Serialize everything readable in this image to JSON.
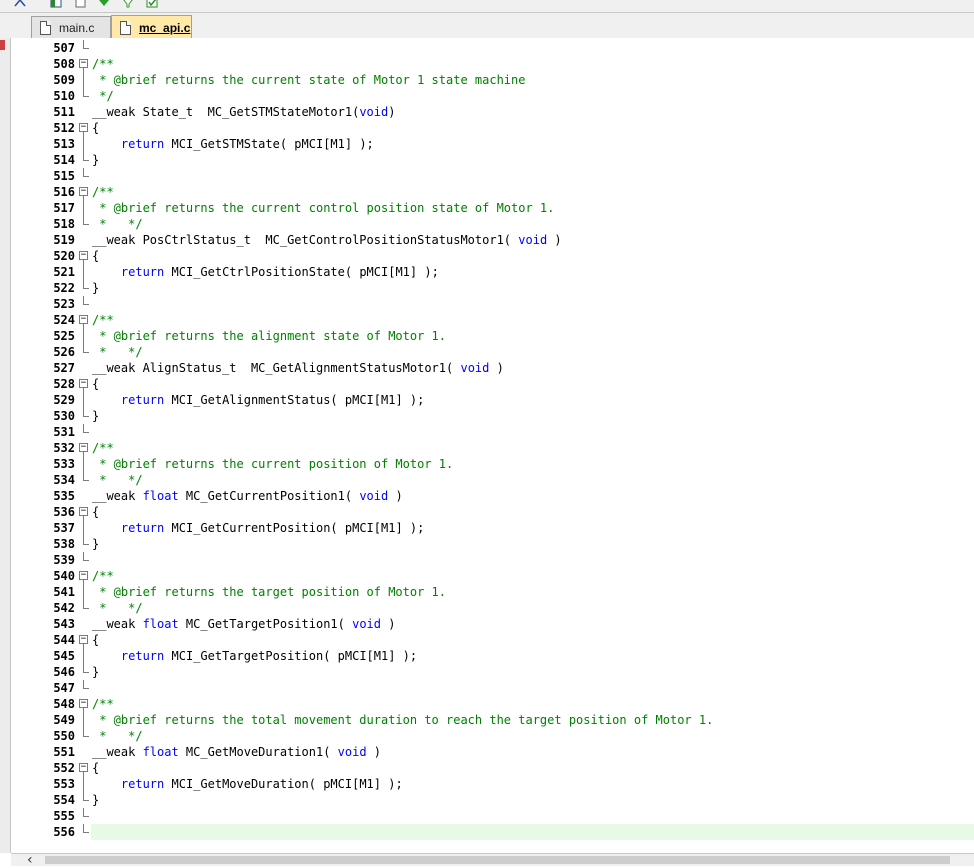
{
  "tabs": [
    {
      "label": "main.c",
      "active": false
    },
    {
      "label": "mc_api.c",
      "active": true
    }
  ],
  "toolbar_icons": [
    "debug-icon",
    "window-icon",
    "window-restore-icon",
    "arrow-down-icon",
    "filter-icon",
    "checkbox-icon"
  ],
  "editor": {
    "current_line": "556",
    "lines": [
      {
        "num": "507",
        "fold": "end",
        "segments": []
      },
      {
        "num": "508",
        "fold": "open",
        "segments": [
          {
            "t": "/**",
            "c": "cm"
          }
        ]
      },
      {
        "num": "509",
        "fold": "bar",
        "segments": [
          {
            "t": " * @brief returns the current state of Motor 1 state machine",
            "c": "cm"
          }
        ]
      },
      {
        "num": "510",
        "fold": "end",
        "segments": [
          {
            "t": " */",
            "c": "cm"
          }
        ]
      },
      {
        "num": "511",
        "fold": "",
        "segments": [
          {
            "t": "__weak State_t  MC_GetSTMStateMotor1(",
            "c": ""
          },
          {
            "t": "void",
            "c": "kw"
          },
          {
            "t": ")",
            "c": ""
          }
        ]
      },
      {
        "num": "512",
        "fold": "open",
        "segments": [
          {
            "t": "{",
            "c": ""
          }
        ]
      },
      {
        "num": "513",
        "fold": "bar",
        "segments": [
          {
            "t": "    ",
            "c": ""
          },
          {
            "t": "return",
            "c": "kw"
          },
          {
            "t": " MCI_GetSTMState( pMCI[M1] );",
            "c": ""
          }
        ]
      },
      {
        "num": "514",
        "fold": "end",
        "segments": [
          {
            "t": "}",
            "c": ""
          }
        ]
      },
      {
        "num": "515",
        "fold": "end",
        "segments": []
      },
      {
        "num": "516",
        "fold": "open",
        "segments": [
          {
            "t": "/**",
            "c": "cm"
          }
        ]
      },
      {
        "num": "517",
        "fold": "bar",
        "segments": [
          {
            "t": " * @brief returns the current control position state of Motor 1.",
            "c": "cm"
          }
        ]
      },
      {
        "num": "518",
        "fold": "end",
        "segments": [
          {
            "t": " *   */",
            "c": "cm"
          }
        ]
      },
      {
        "num": "519",
        "fold": "",
        "segments": [
          {
            "t": "__weak PosCtrlStatus_t  MC_GetControlPositionStatusMotor1( ",
            "c": ""
          },
          {
            "t": "void",
            "c": "kw"
          },
          {
            "t": " )",
            "c": ""
          }
        ]
      },
      {
        "num": "520",
        "fold": "open",
        "segments": [
          {
            "t": "{",
            "c": ""
          }
        ]
      },
      {
        "num": "521",
        "fold": "bar",
        "segments": [
          {
            "t": "    ",
            "c": ""
          },
          {
            "t": "return",
            "c": "kw"
          },
          {
            "t": " MCI_GetCtrlPositionState( pMCI[M1] );",
            "c": ""
          }
        ]
      },
      {
        "num": "522",
        "fold": "end",
        "segments": [
          {
            "t": "}",
            "c": ""
          }
        ]
      },
      {
        "num": "523",
        "fold": "end",
        "segments": []
      },
      {
        "num": "524",
        "fold": "open",
        "segments": [
          {
            "t": "/**",
            "c": "cm"
          }
        ]
      },
      {
        "num": "525",
        "fold": "bar",
        "segments": [
          {
            "t": " * @brief returns the alignment state of Motor 1.",
            "c": "cm"
          }
        ]
      },
      {
        "num": "526",
        "fold": "end",
        "segments": [
          {
            "t": " *   */",
            "c": "cm"
          }
        ]
      },
      {
        "num": "527",
        "fold": "",
        "segments": [
          {
            "t": "__weak AlignStatus_t  MC_GetAlignmentStatusMotor1( ",
            "c": ""
          },
          {
            "t": "void",
            "c": "kw"
          },
          {
            "t": " )",
            "c": ""
          }
        ]
      },
      {
        "num": "528",
        "fold": "open",
        "segments": [
          {
            "t": "{",
            "c": ""
          }
        ]
      },
      {
        "num": "529",
        "fold": "bar",
        "segments": [
          {
            "t": "    ",
            "c": ""
          },
          {
            "t": "return",
            "c": "kw"
          },
          {
            "t": " MCI_GetAlignmentStatus( pMCI[M1] );",
            "c": ""
          }
        ]
      },
      {
        "num": "530",
        "fold": "end",
        "segments": [
          {
            "t": "}",
            "c": ""
          }
        ]
      },
      {
        "num": "531",
        "fold": "end",
        "segments": []
      },
      {
        "num": "532",
        "fold": "open",
        "segments": [
          {
            "t": "/**",
            "c": "cm"
          }
        ]
      },
      {
        "num": "533",
        "fold": "bar",
        "segments": [
          {
            "t": " * @brief returns the current position of Motor 1.",
            "c": "cm"
          }
        ]
      },
      {
        "num": "534",
        "fold": "end",
        "segments": [
          {
            "t": " *   */",
            "c": "cm"
          }
        ]
      },
      {
        "num": "535",
        "fold": "",
        "segments": [
          {
            "t": "__weak ",
            "c": ""
          },
          {
            "t": "float",
            "c": "kw"
          },
          {
            "t": " MC_GetCurrentPosition1( ",
            "c": ""
          },
          {
            "t": "void",
            "c": "kw"
          },
          {
            "t": " )",
            "c": ""
          }
        ]
      },
      {
        "num": "536",
        "fold": "open",
        "segments": [
          {
            "t": "{",
            "c": ""
          }
        ]
      },
      {
        "num": "537",
        "fold": "bar",
        "segments": [
          {
            "t": "    ",
            "c": ""
          },
          {
            "t": "return",
            "c": "kw"
          },
          {
            "t": " MCI_GetCurrentPosition( pMCI[M1] );",
            "c": ""
          }
        ]
      },
      {
        "num": "538",
        "fold": "end",
        "segments": [
          {
            "t": "}",
            "c": ""
          }
        ]
      },
      {
        "num": "539",
        "fold": "end",
        "segments": []
      },
      {
        "num": "540",
        "fold": "open",
        "segments": [
          {
            "t": "/**",
            "c": "cm"
          }
        ]
      },
      {
        "num": "541",
        "fold": "bar",
        "segments": [
          {
            "t": " * @brief returns the target position of Motor 1.",
            "c": "cm"
          }
        ]
      },
      {
        "num": "542",
        "fold": "end",
        "segments": [
          {
            "t": " *   */",
            "c": "cm"
          }
        ]
      },
      {
        "num": "543",
        "fold": "",
        "segments": [
          {
            "t": "__weak ",
            "c": ""
          },
          {
            "t": "float",
            "c": "kw"
          },
          {
            "t": " MC_GetTargetPosition1( ",
            "c": ""
          },
          {
            "t": "void",
            "c": "kw"
          },
          {
            "t": " )",
            "c": ""
          }
        ]
      },
      {
        "num": "544",
        "fold": "open",
        "segments": [
          {
            "t": "{",
            "c": ""
          }
        ]
      },
      {
        "num": "545",
        "fold": "bar",
        "segments": [
          {
            "t": "    ",
            "c": ""
          },
          {
            "t": "return",
            "c": "kw"
          },
          {
            "t": " MCI_GetTargetPosition( pMCI[M1] );",
            "c": ""
          }
        ]
      },
      {
        "num": "546",
        "fold": "end",
        "segments": [
          {
            "t": "}",
            "c": ""
          }
        ]
      },
      {
        "num": "547",
        "fold": "end",
        "segments": []
      },
      {
        "num": "548",
        "fold": "open",
        "segments": [
          {
            "t": "/**",
            "c": "cm"
          }
        ]
      },
      {
        "num": "549",
        "fold": "bar",
        "segments": [
          {
            "t": " * @brief returns the total movement duration to reach the target position of Motor 1.",
            "c": "cm"
          }
        ]
      },
      {
        "num": "550",
        "fold": "end",
        "segments": [
          {
            "t": " *   */",
            "c": "cm"
          }
        ]
      },
      {
        "num": "551",
        "fold": "",
        "segments": [
          {
            "t": "__weak ",
            "c": ""
          },
          {
            "t": "float",
            "c": "kw"
          },
          {
            "t": " MC_GetMoveDuration1( ",
            "c": ""
          },
          {
            "t": "void",
            "c": "kw"
          },
          {
            "t": " )",
            "c": ""
          }
        ]
      },
      {
        "num": "552",
        "fold": "open",
        "segments": [
          {
            "t": "{",
            "c": ""
          }
        ]
      },
      {
        "num": "553",
        "fold": "bar",
        "segments": [
          {
            "t": "    ",
            "c": ""
          },
          {
            "t": "return",
            "c": "kw"
          },
          {
            "t": " MCI_GetMoveDuration( pMCI[M1] );",
            "c": ""
          }
        ]
      },
      {
        "num": "554",
        "fold": "end",
        "segments": [
          {
            "t": "}",
            "c": ""
          }
        ]
      },
      {
        "num": "555",
        "fold": "end",
        "segments": []
      },
      {
        "num": "556",
        "fold": "end",
        "segments": []
      }
    ]
  },
  "colors": {
    "comment": "#008000",
    "keyword": "#0000ff",
    "current_line": "#e6fae6",
    "active_tab": "#ffe8a8"
  }
}
